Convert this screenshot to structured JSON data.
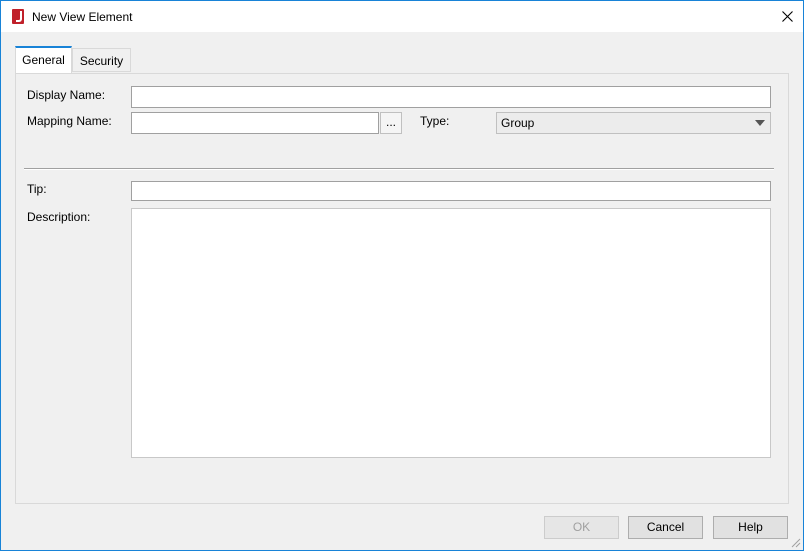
{
  "window": {
    "title": "New View Element",
    "app_icon": "report-app-icon",
    "close_icon": "close-icon"
  },
  "tabs": [
    {
      "label": "General",
      "active": true
    },
    {
      "label": "Security",
      "active": false
    }
  ],
  "general": {
    "display_name": {
      "label": "Display Name:",
      "value": ""
    },
    "mapping_name": {
      "label": "Mapping Name:",
      "value": "",
      "browse_label": "..."
    },
    "type": {
      "label": "Type:",
      "value": "Group"
    },
    "tip": {
      "label": "Tip:",
      "value": ""
    },
    "description": {
      "label": "Description:",
      "value": ""
    }
  },
  "footer": {
    "ok": "OK",
    "cancel": "Cancel",
    "help": "Help"
  },
  "colors": {
    "accent": "#1883d7",
    "app_icon": "#c0202a"
  }
}
